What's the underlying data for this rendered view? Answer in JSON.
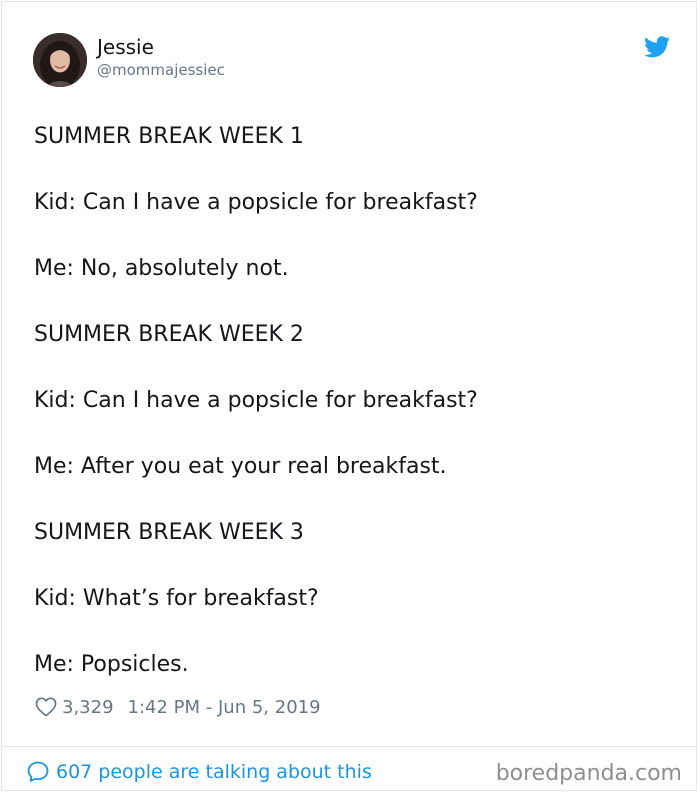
{
  "author": {
    "name": "Jessie",
    "handle": "@mommajessiec"
  },
  "tweet": {
    "lines": [
      "SUMMER BREAK WEEK 1",
      "Kid: Can I have a popsicle for breakfast?",
      "Me: No, absolutely not.",
      "SUMMER BREAK WEEK 2",
      "Kid: Can I have a popsicle for breakfast?",
      "Me: After you eat your real breakfast.",
      "SUMMER BREAK WEEK 3",
      "Kid: What’s for breakfast?",
      "Me: Popsicles."
    ]
  },
  "meta": {
    "likes": "3,329",
    "timestamp": "1:42 PM - Jun 5, 2019"
  },
  "footer": {
    "talking": "607 people are talking about this",
    "watermark": "boredpanda.com"
  },
  "icons": {
    "platform": "twitter-bird-icon",
    "like": "heart-icon",
    "comments": "speech-bubble-icon"
  },
  "colors": {
    "brand_blue": "#1da1f2",
    "link_blue": "#1b95e0",
    "text": "#14171a",
    "muted": "#657786"
  }
}
